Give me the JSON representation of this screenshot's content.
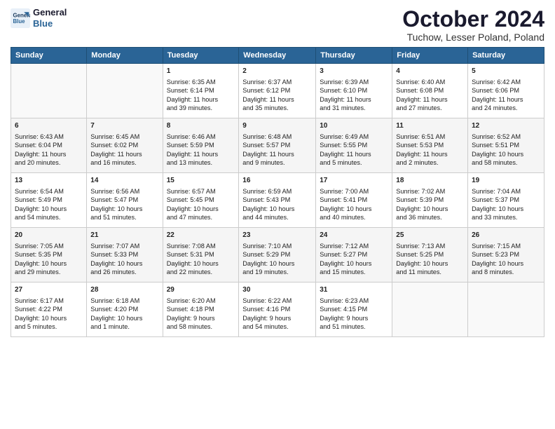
{
  "header": {
    "logo_line1": "General",
    "logo_line2": "Blue",
    "month": "October 2024",
    "location": "Tuchow, Lesser Poland, Poland"
  },
  "days_of_week": [
    "Sunday",
    "Monday",
    "Tuesday",
    "Wednesday",
    "Thursday",
    "Friday",
    "Saturday"
  ],
  "weeks": [
    [
      {
        "day": "",
        "info": ""
      },
      {
        "day": "",
        "info": ""
      },
      {
        "day": "1",
        "info": "Sunrise: 6:35 AM\nSunset: 6:14 PM\nDaylight: 11 hours\nand 39 minutes."
      },
      {
        "day": "2",
        "info": "Sunrise: 6:37 AM\nSunset: 6:12 PM\nDaylight: 11 hours\nand 35 minutes."
      },
      {
        "day": "3",
        "info": "Sunrise: 6:39 AM\nSunset: 6:10 PM\nDaylight: 11 hours\nand 31 minutes."
      },
      {
        "day": "4",
        "info": "Sunrise: 6:40 AM\nSunset: 6:08 PM\nDaylight: 11 hours\nand 27 minutes."
      },
      {
        "day": "5",
        "info": "Sunrise: 6:42 AM\nSunset: 6:06 PM\nDaylight: 11 hours\nand 24 minutes."
      }
    ],
    [
      {
        "day": "6",
        "info": "Sunrise: 6:43 AM\nSunset: 6:04 PM\nDaylight: 11 hours\nand 20 minutes."
      },
      {
        "day": "7",
        "info": "Sunrise: 6:45 AM\nSunset: 6:02 PM\nDaylight: 11 hours\nand 16 minutes."
      },
      {
        "day": "8",
        "info": "Sunrise: 6:46 AM\nSunset: 5:59 PM\nDaylight: 11 hours\nand 13 minutes."
      },
      {
        "day": "9",
        "info": "Sunrise: 6:48 AM\nSunset: 5:57 PM\nDaylight: 11 hours\nand 9 minutes."
      },
      {
        "day": "10",
        "info": "Sunrise: 6:49 AM\nSunset: 5:55 PM\nDaylight: 11 hours\nand 5 minutes."
      },
      {
        "day": "11",
        "info": "Sunrise: 6:51 AM\nSunset: 5:53 PM\nDaylight: 11 hours\nand 2 minutes."
      },
      {
        "day": "12",
        "info": "Sunrise: 6:52 AM\nSunset: 5:51 PM\nDaylight: 10 hours\nand 58 minutes."
      }
    ],
    [
      {
        "day": "13",
        "info": "Sunrise: 6:54 AM\nSunset: 5:49 PM\nDaylight: 10 hours\nand 54 minutes."
      },
      {
        "day": "14",
        "info": "Sunrise: 6:56 AM\nSunset: 5:47 PM\nDaylight: 10 hours\nand 51 minutes."
      },
      {
        "day": "15",
        "info": "Sunrise: 6:57 AM\nSunset: 5:45 PM\nDaylight: 10 hours\nand 47 minutes."
      },
      {
        "day": "16",
        "info": "Sunrise: 6:59 AM\nSunset: 5:43 PM\nDaylight: 10 hours\nand 44 minutes."
      },
      {
        "day": "17",
        "info": "Sunrise: 7:00 AM\nSunset: 5:41 PM\nDaylight: 10 hours\nand 40 minutes."
      },
      {
        "day": "18",
        "info": "Sunrise: 7:02 AM\nSunset: 5:39 PM\nDaylight: 10 hours\nand 36 minutes."
      },
      {
        "day": "19",
        "info": "Sunrise: 7:04 AM\nSunset: 5:37 PM\nDaylight: 10 hours\nand 33 minutes."
      }
    ],
    [
      {
        "day": "20",
        "info": "Sunrise: 7:05 AM\nSunset: 5:35 PM\nDaylight: 10 hours\nand 29 minutes."
      },
      {
        "day": "21",
        "info": "Sunrise: 7:07 AM\nSunset: 5:33 PM\nDaylight: 10 hours\nand 26 minutes."
      },
      {
        "day": "22",
        "info": "Sunrise: 7:08 AM\nSunset: 5:31 PM\nDaylight: 10 hours\nand 22 minutes."
      },
      {
        "day": "23",
        "info": "Sunrise: 7:10 AM\nSunset: 5:29 PM\nDaylight: 10 hours\nand 19 minutes."
      },
      {
        "day": "24",
        "info": "Sunrise: 7:12 AM\nSunset: 5:27 PM\nDaylight: 10 hours\nand 15 minutes."
      },
      {
        "day": "25",
        "info": "Sunrise: 7:13 AM\nSunset: 5:25 PM\nDaylight: 10 hours\nand 11 minutes."
      },
      {
        "day": "26",
        "info": "Sunrise: 7:15 AM\nSunset: 5:23 PM\nDaylight: 10 hours\nand 8 minutes."
      }
    ],
    [
      {
        "day": "27",
        "info": "Sunrise: 6:17 AM\nSunset: 4:22 PM\nDaylight: 10 hours\nand 5 minutes."
      },
      {
        "day": "28",
        "info": "Sunrise: 6:18 AM\nSunset: 4:20 PM\nDaylight: 10 hours\nand 1 minute."
      },
      {
        "day": "29",
        "info": "Sunrise: 6:20 AM\nSunset: 4:18 PM\nDaylight: 9 hours\nand 58 minutes."
      },
      {
        "day": "30",
        "info": "Sunrise: 6:22 AM\nSunset: 4:16 PM\nDaylight: 9 hours\nand 54 minutes."
      },
      {
        "day": "31",
        "info": "Sunrise: 6:23 AM\nSunset: 4:15 PM\nDaylight: 9 hours\nand 51 minutes."
      },
      {
        "day": "",
        "info": ""
      },
      {
        "day": "",
        "info": ""
      }
    ]
  ]
}
